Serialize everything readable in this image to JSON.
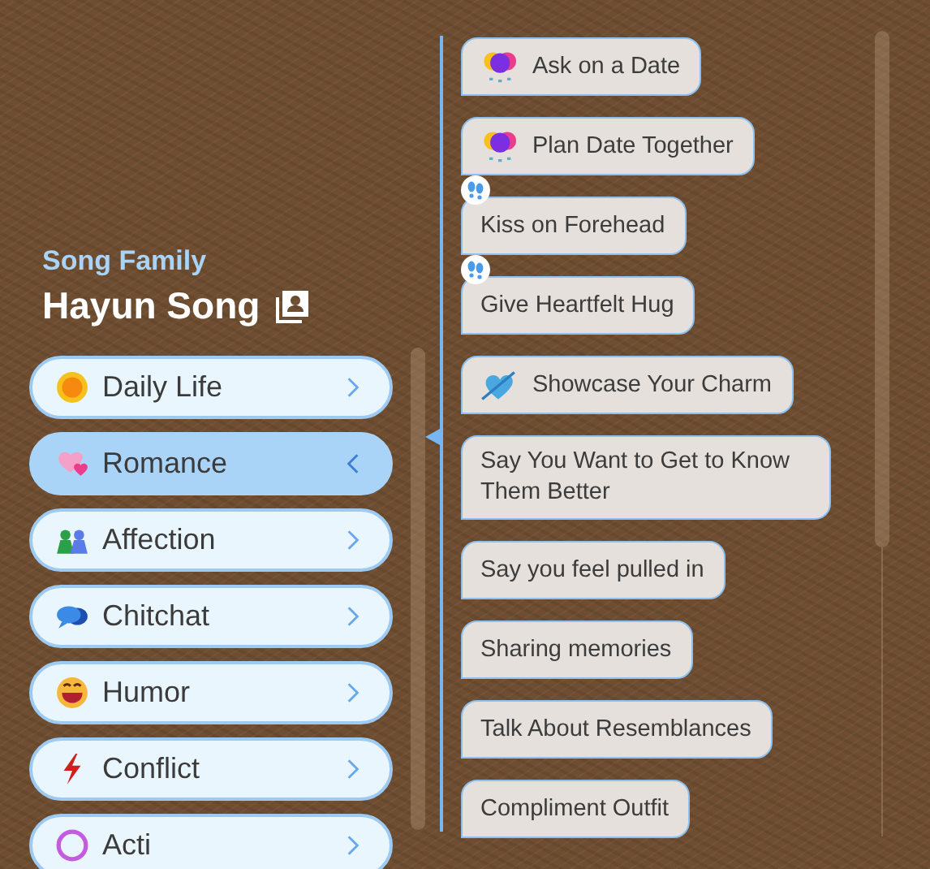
{
  "family": {
    "label": "Song Family"
  },
  "character": {
    "name": "Hayun Song"
  },
  "categories": [
    {
      "label": "Daily Life",
      "kind": "sun",
      "selected": false
    },
    {
      "label": "Romance",
      "kind": "hearts",
      "selected": true
    },
    {
      "label": "Affection",
      "kind": "people",
      "selected": false
    },
    {
      "label": "Chitchat",
      "kind": "chat",
      "selected": false
    },
    {
      "label": "Humor",
      "kind": "grin",
      "selected": false
    },
    {
      "label": "Conflict",
      "kind": "bolt",
      "selected": false
    },
    {
      "label": "Acti",
      "kind": "ring",
      "selected": false
    }
  ],
  "actions": [
    {
      "label": "Ask on a Date",
      "kind": "balloons",
      "footprints": false
    },
    {
      "label": "Plan Date Together",
      "kind": "balloons",
      "footprints": false
    },
    {
      "label": "Kiss on Forehead",
      "kind": "plain",
      "footprints": true
    },
    {
      "label": "Give Heartfelt Hug",
      "kind": "plain",
      "footprints": true
    },
    {
      "label": "Showcase Your Charm",
      "kind": "heart-arrow",
      "footprints": false
    },
    {
      "label": "Say You Want to Get to Know Them Better",
      "kind": "plain",
      "footprints": false
    },
    {
      "label": "Say you feel pulled in",
      "kind": "plain",
      "footprints": false
    },
    {
      "label": "Sharing memories",
      "kind": "plain",
      "footprints": false
    },
    {
      "label": "Talk About Resemblances",
      "kind": "plain",
      "footprints": false
    },
    {
      "label": "Compliment Outfit",
      "kind": "plain",
      "footprints": false
    }
  ]
}
